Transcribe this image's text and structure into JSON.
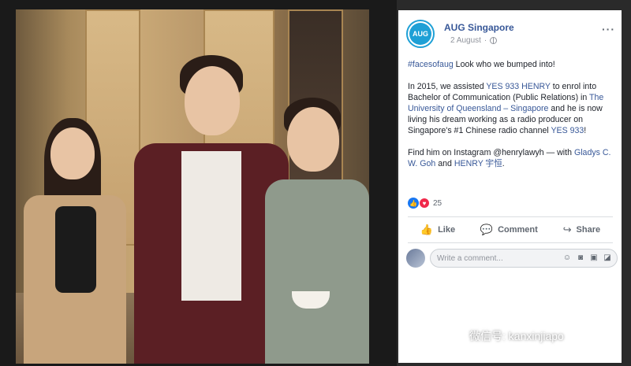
{
  "post": {
    "page_name": "AUG Singapore",
    "avatar_text": "AUG",
    "date": "2 August",
    "more": "···",
    "paragraph1": {
      "hashtag": "#facesofaug",
      "text": " Look who we bumped into!"
    },
    "paragraph2": {
      "t1": "In 2015, we assisted ",
      "link1": "YES 933 HENRY",
      "t2": " to enrol into Bachelor of Communication (Public Relations) in ",
      "link2": "The University of Queensland – Singapore",
      "t3": " and he is now living his dream working as a radio producer on Singapore's #1 Chinese radio channel ",
      "link3": "YES 933",
      "t4": "!"
    },
    "paragraph3": {
      "t1": "Find him on Instagram @henrylawyh — with ",
      "link1": "Gladys C. W. Goh",
      "t2": " and ",
      "link2": "HENRY 宇恒",
      "t3": "."
    },
    "reaction_count": "25"
  },
  "actions": {
    "like": "Like",
    "comment": "Comment",
    "share": "Share"
  },
  "comment_box": {
    "placeholder": "Write a comment..."
  },
  "watermark": {
    "text": "微信号: kanxinjiapo"
  },
  "colors": {
    "link": "#385898",
    "brand": "#1ea0d6",
    "like_blue": "#1877f2",
    "love_red": "#f0284a"
  }
}
